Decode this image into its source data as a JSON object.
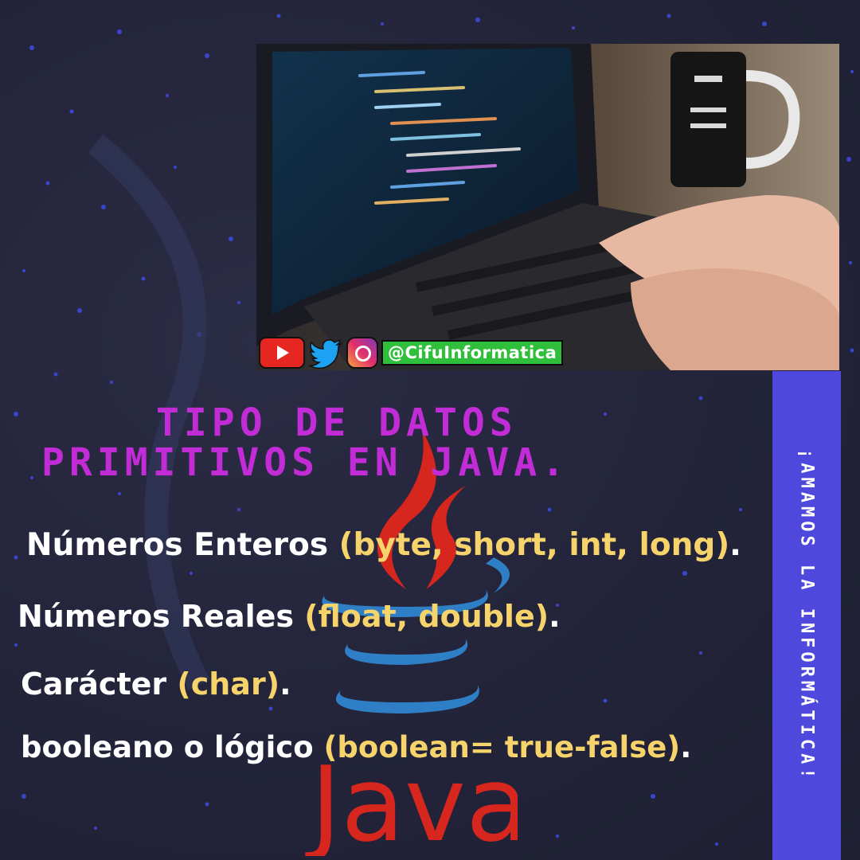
{
  "photo": {
    "social": {
      "youtube_icon": "youtube-icon",
      "twitter_icon": "twitter-icon",
      "instagram_icon": "instagram-icon",
      "handle": "@CifuInformatica"
    }
  },
  "title": {
    "line1": "TIPO DE DATOS",
    "line2": "PRIMITIVOS EN JAVA."
  },
  "items": [
    {
      "label": "Números Enteros ",
      "detail": "(byte, short, int, long)",
      "end": "."
    },
    {
      "label": "Números Reales ",
      "detail": "(float, double)",
      "end": "."
    },
    {
      "label": "Carácter ",
      "detail": "(char)",
      "end": "."
    },
    {
      "label": "booleano o lógico ",
      "detail": "(boolean= true-false)",
      "end": "."
    }
  ],
  "logo": {
    "wordmark": "Java"
  },
  "sidebar": {
    "text": "¡AMAMOS LA INFORMÁTICA!"
  },
  "colors": {
    "background": "#24253a",
    "title": "#c22cd6",
    "text": "#ffffff",
    "highlight": "#f6d36b",
    "sidebar": "#4e48dc",
    "java_red": "#d7261e",
    "java_blue": "#2f7fc6"
  }
}
